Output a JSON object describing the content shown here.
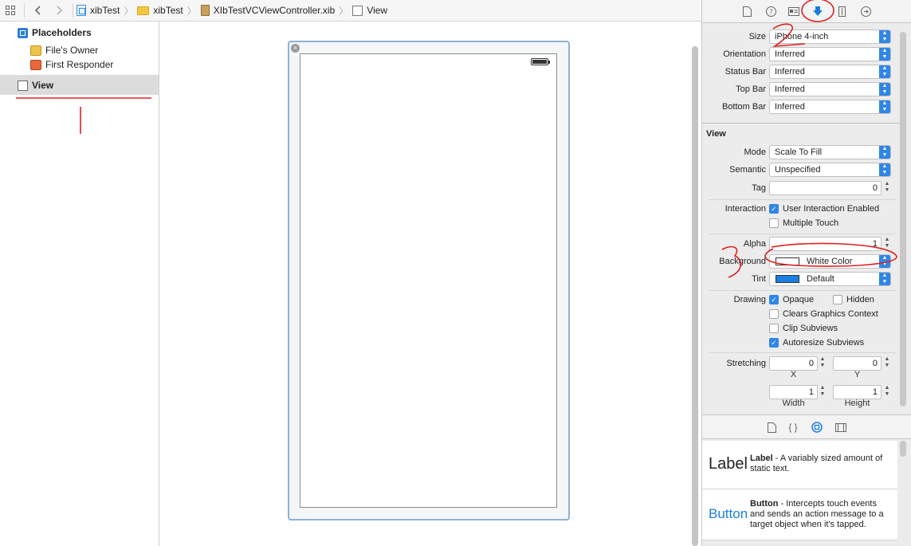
{
  "breadcrumb": [
    "xibTest",
    "xibTest",
    "XIbTestVCViewController.xib",
    "View"
  ],
  "outline": {
    "placeholders": "Placeholders",
    "files_owner": "File's Owner",
    "first_responder": "First Responder",
    "view": "View"
  },
  "inspector": {
    "simulated": [
      {
        "label": "Size",
        "value": "iPhone 4-inch"
      },
      {
        "label": "Orientation",
        "value": "Inferred"
      },
      {
        "label": "Status Bar",
        "value": "Inferred"
      },
      {
        "label": "Top Bar",
        "value": "Inferred"
      },
      {
        "label": "Bottom Bar",
        "value": "Inferred"
      }
    ],
    "view_section": "View",
    "mode": {
      "label": "Mode",
      "value": "Scale To Fill"
    },
    "semantic": {
      "label": "Semantic",
      "value": "Unspecified"
    },
    "tag": {
      "label": "Tag",
      "value": "0"
    },
    "interaction": {
      "label": "Interaction",
      "user_interaction": "User Interaction Enabled",
      "multiple_touch": "Multiple Touch"
    },
    "alpha": {
      "label": "Alpha",
      "value": "1"
    },
    "background": {
      "label": "Background",
      "value": "White Color",
      "color": "#ffffff"
    },
    "tint": {
      "label": "Tint",
      "value": "Default",
      "color": "#1a7fe0"
    },
    "drawing": {
      "label": "Drawing",
      "opaque": "Opaque",
      "hidden": "Hidden",
      "clears": "Clears Graphics Context",
      "clip": "Clip Subviews",
      "autoresize": "Autoresize Subviews"
    },
    "stretching": {
      "label": "Stretching",
      "x": "0",
      "y": "0",
      "width": "1",
      "height": "1",
      "x_caption": "X",
      "y_caption": "Y",
      "width_caption": "Width",
      "height_caption": "Height"
    }
  },
  "library": [
    {
      "big": "Label",
      "title": "Label",
      "desc": " - A variably sized amount of static text."
    },
    {
      "big": "Button",
      "title": "Button",
      "desc": " - Intercepts touch events and sends an action message to a target object when it's tapped."
    }
  ],
  "colors": {
    "accent": "#2f86e8",
    "annotation": "#e02020"
  }
}
